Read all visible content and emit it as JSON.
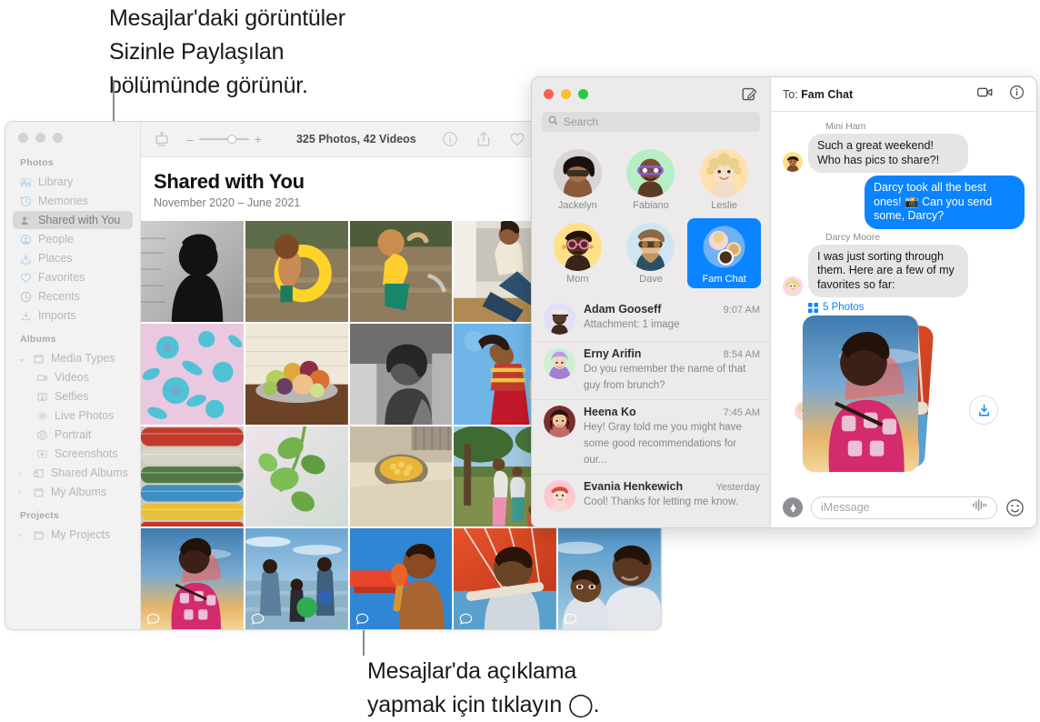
{
  "annotations": {
    "top": "Mesajlar'daki görüntüler\nSizinle Paylaşılan\nbölümünde görünür.",
    "bottom": "Mesajlar'da açıklama\nyapmak için tıklayın ◯."
  },
  "photos_app": {
    "toolbar": {
      "sidebar_toggle_icon": "sidebar-toggle-icon",
      "zoom_out_label": "–",
      "zoom_in_label": "+",
      "count_label": "325 Photos, 42 Videos",
      "info_icon": "info-icon",
      "share_icon": "share-icon",
      "favorite_icon": "heart-icon",
      "rotate_icon": "rotate-icon"
    },
    "header": {
      "title": "Shared with You",
      "subtitle": "November 2020 – June 2021"
    },
    "sidebar": {
      "sections": [
        {
          "label": "Photos",
          "items": [
            {
              "label": "Library",
              "icon": "library-icon",
              "selected": false
            },
            {
              "label": "Memories",
              "icon": "memories-icon",
              "selected": false
            },
            {
              "label": "Shared with You",
              "icon": "shared-icon",
              "selected": true
            },
            {
              "label": "People",
              "icon": "people-icon",
              "selected": false
            },
            {
              "label": "Places",
              "icon": "places-icon",
              "selected": false
            },
            {
              "label": "Favorites",
              "icon": "heart-icon",
              "selected": false
            },
            {
              "label": "Recents",
              "icon": "clock-icon",
              "selected": false
            },
            {
              "label": "Imports",
              "icon": "import-icon",
              "selected": false
            }
          ]
        },
        {
          "label": "Albums",
          "items": [
            {
              "label": "Media Types",
              "icon": "folder-icon",
              "twisty": "down",
              "indent": false
            },
            {
              "label": "Videos",
              "icon": "video-icon",
              "twisty": "none",
              "indent": true
            },
            {
              "label": "Selfies",
              "icon": "selfie-icon",
              "twisty": "none",
              "indent": true
            },
            {
              "label": "Live Photos",
              "icon": "live-photo-icon",
              "twisty": "none",
              "indent": true
            },
            {
              "label": "Portrait",
              "icon": "portrait-icon",
              "twisty": "none",
              "indent": true
            },
            {
              "label": "Screenshots",
              "icon": "screenshot-icon",
              "twisty": "none",
              "indent": true
            },
            {
              "label": "Shared Albums",
              "icon": "shared-album-icon",
              "twisty": "right",
              "indent": false
            },
            {
              "label": "My Albums",
              "icon": "folder-icon",
              "twisty": "right",
              "indent": false
            }
          ]
        },
        {
          "label": "Projects",
          "items": [
            {
              "label": "My Projects",
              "icon": "folder-icon",
              "twisty": "right",
              "indent": false
            }
          ]
        }
      ]
    },
    "grid": {
      "rows": 4,
      "columns": 5,
      "comment_badge_icon": "comment-bubble-icon",
      "cells": [
        {
          "name": "silhouette-portrait-bw",
          "comment": false
        },
        {
          "name": "child-yellow-float-river",
          "comment": false
        },
        {
          "name": "child-running-water",
          "comment": false
        },
        {
          "name": "man-sitting-wall",
          "comment": false
        },
        {
          "name": "sky-clouds-partial",
          "comment": false
        },
        {
          "name": "blue-floral-fabric",
          "comment": false
        },
        {
          "name": "fruit-bowl-table",
          "comment": false
        },
        {
          "name": "woman-portrait-bw",
          "comment": false
        },
        {
          "name": "woman-red-pants-sky",
          "comment": false
        },
        {
          "name": "red-stripes-partial",
          "comment": false
        },
        {
          "name": "colored-pipes",
          "comment": false
        },
        {
          "name": "green-leaves-vine",
          "comment": false
        },
        {
          "name": "yellow-corn-bowl",
          "comment": false
        },
        {
          "name": "family-under-tree",
          "comment": false
        },
        {
          "name": "green-field-partial",
          "comment": false
        },
        {
          "name": "woman-pink-dress-sunset",
          "comment": true
        },
        {
          "name": "people-beach-ball",
          "comment": true
        },
        {
          "name": "boy-orange-umbrella",
          "comment": true
        },
        {
          "name": "man-orange-parasol",
          "comment": true
        },
        {
          "name": "boy-and-man-portrait",
          "comment": true
        }
      ]
    }
  },
  "messages_app": {
    "window_controls": {
      "close": "close-button",
      "minimize": "minimize-button",
      "zoom": "zoom-button"
    },
    "compose_icon": "compose-icon",
    "search": {
      "placeholder": "Search",
      "value": "",
      "icon": "search-icon"
    },
    "pinned": [
      {
        "name": "Jackelyn",
        "active": false,
        "avatar": "photo-woman-sunglasses",
        "bg": "#dcdcdc"
      },
      {
        "name": "Fabiano",
        "active": false,
        "avatar": "memoji-man-purple-glasses",
        "bg": "#b6efc4"
      },
      {
        "name": "Leslie",
        "active": false,
        "avatar": "memoji-blond-curly",
        "bg": "#ffe0ae"
      },
      {
        "name": "Mom",
        "active": false,
        "avatar": "memoji-pink-glasses",
        "bg": "#ffe08a"
      },
      {
        "name": "Dave",
        "active": false,
        "avatar": "photo-man-sunglasses",
        "bg": "#cfe6f2"
      },
      {
        "name": "Fam Chat",
        "active": true,
        "avatar": "group-avatar",
        "bg": "#6cb2f5"
      }
    ],
    "conversations": [
      {
        "name": "Adam Gooseff",
        "time": "9:07 AM",
        "preview": "Attachment: 1 image",
        "avatar_bg": "#e6ddf7"
      },
      {
        "name": "Erny Arifin",
        "time": "8:54 AM",
        "preview": "Do you remember the name of that guy from brunch?",
        "avatar_bg": "#cdf0d4"
      },
      {
        "name": "Heena Ko",
        "time": "7:45 AM",
        "preview": "Hey! Gray told me you might have some good recommendations for our...",
        "avatar_bg": "#7b2d2d"
      },
      {
        "name": "Evania Henkewich",
        "time": "Yesterday",
        "preview": "Cool! Thanks for letting me know.",
        "avatar_bg": "#ffc7d0"
      }
    ],
    "chat": {
      "to_label": "To:",
      "to_value": "Fam Chat",
      "facetime_icon": "video-camera-icon",
      "info_icon": "info-icon",
      "messages": [
        {
          "sender": "Mini Ham",
          "text": "Such a great weekend! Who has pics to share?!",
          "direction": "in",
          "avatar_bg": "#ffe08a"
        },
        {
          "sender": "",
          "text": "Darcy took all the best ones! 📸 Can you send some, Darcy?",
          "direction": "out",
          "avatar_bg": ""
        },
        {
          "sender": "Darcy Moore",
          "text": "I was just sorting through them. Here are a few of my favorites so far:",
          "direction": "in",
          "avatar_bg": "#ffd4e2"
        }
      ],
      "attachment": {
        "label": "5 Photos",
        "grid_icon": "grid-icon",
        "save_icon": "save-download-icon",
        "top_photo": "woman-pink-dress-sunset"
      },
      "input": {
        "apps_icon": "app-store-icon",
        "placeholder": "iMessage",
        "value": "",
        "audio_icon": "audio-waveform-icon",
        "emoji_icon": "emoji-smiley-icon"
      }
    }
  }
}
